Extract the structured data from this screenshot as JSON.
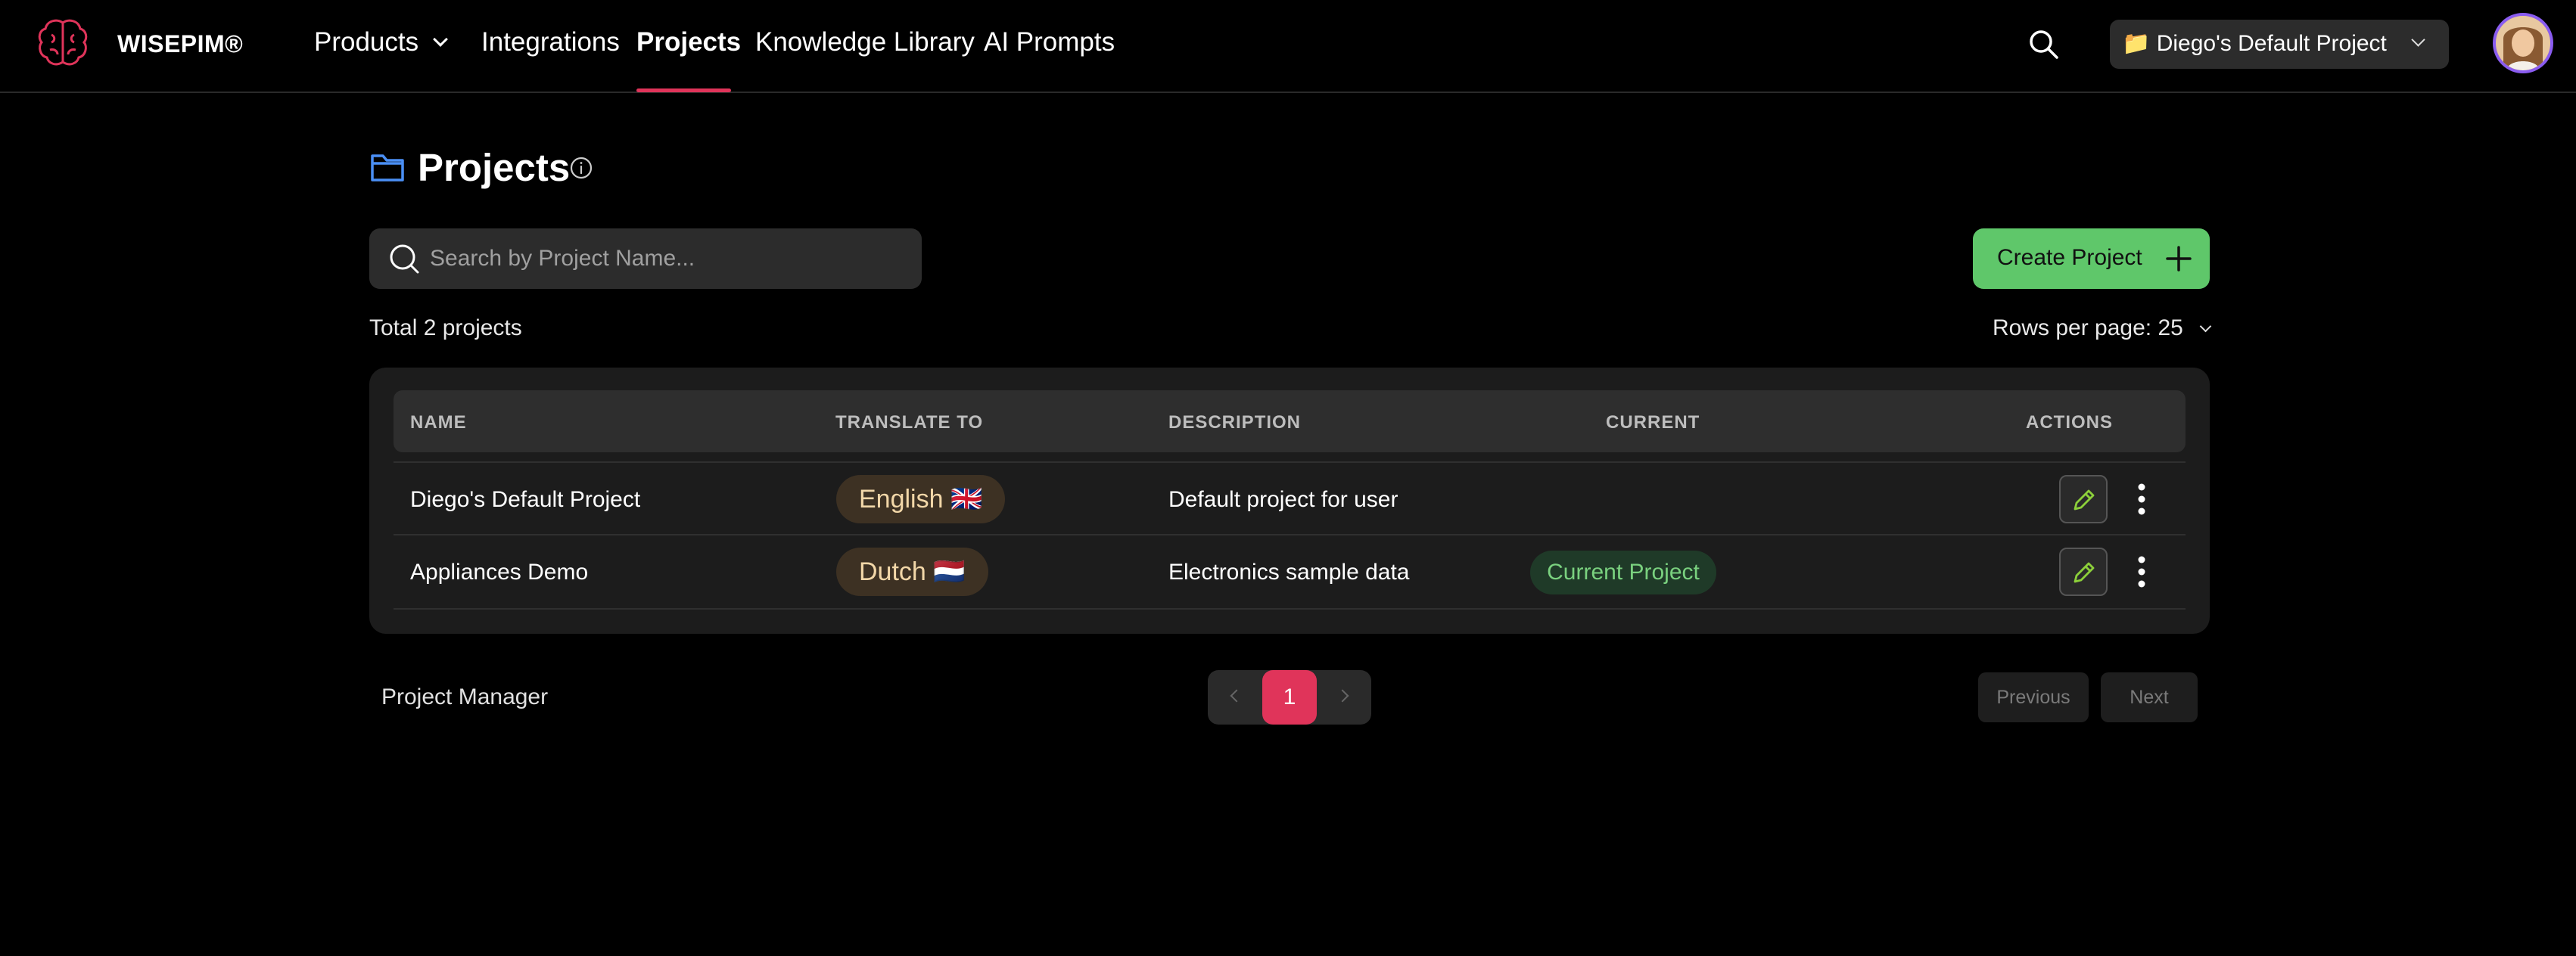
{
  "app": {
    "brand": "WISEPIM®"
  },
  "nav": {
    "items": [
      {
        "label": "Products",
        "has_dropdown": true
      },
      {
        "label": "Integrations"
      },
      {
        "label": "Projects",
        "active": true
      },
      {
        "label": "Knowledge Library"
      },
      {
        "label": "AI Prompts"
      }
    ]
  },
  "header": {
    "project_switcher": "📁 Diego's Default Project",
    "search_icon": "search-icon",
    "avatar_icon": "user-avatar"
  },
  "page": {
    "title": "Projects",
    "title_icon": "folder-icon",
    "info_icon": "info-icon"
  },
  "search": {
    "placeholder": "Search by Project Name...",
    "value": ""
  },
  "create_button": {
    "label": "Create Project"
  },
  "summary": {
    "total": "Total 2 projects",
    "rows_per_page": "Rows per page: 25"
  },
  "table": {
    "columns": [
      "NAME",
      "TRANSLATE TO",
      "DESCRIPTION",
      "CURRENT",
      "ACTIONS"
    ],
    "rows": [
      {
        "name": "Diego's Default Project",
        "translate_to": "English 🇬🇧",
        "description": "Default project for user",
        "current": ""
      },
      {
        "name": "Appliances Demo",
        "translate_to": "Dutch 🇳🇱",
        "description": "Electronics sample data",
        "current": "Current Project"
      }
    ]
  },
  "footer": {
    "label": "Project Manager",
    "current_page": "1",
    "previous": "Previous",
    "next": "Next"
  },
  "colors": {
    "accent": "#e0345a",
    "primary_button": "#5fc76a",
    "current_badge_text": "#7ad17f",
    "edit_icon": "#8ccf3a",
    "folder_icon": "#4a8ff5"
  }
}
